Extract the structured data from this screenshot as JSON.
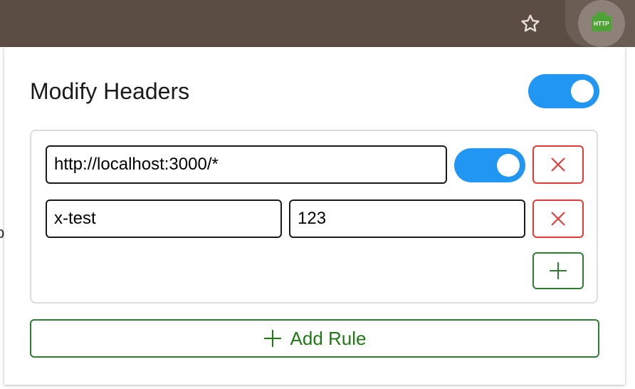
{
  "browser": {
    "bookmark_icon": "star-icon",
    "extension_icon_text": "HTTP"
  },
  "popup": {
    "title": "Modify Headers",
    "global_enabled": true,
    "rules": [
      {
        "url_pattern": "http://localhost:3000/*",
        "enabled": true,
        "headers": [
          {
            "name": "x-test",
            "value": "123"
          }
        ]
      }
    ],
    "add_rule_label": "Add Rule"
  },
  "colors": {
    "toolbar": "#5b4d43",
    "toggle_on": "#2196f3",
    "danger": "#e53935",
    "success": "#2e7d32"
  }
}
